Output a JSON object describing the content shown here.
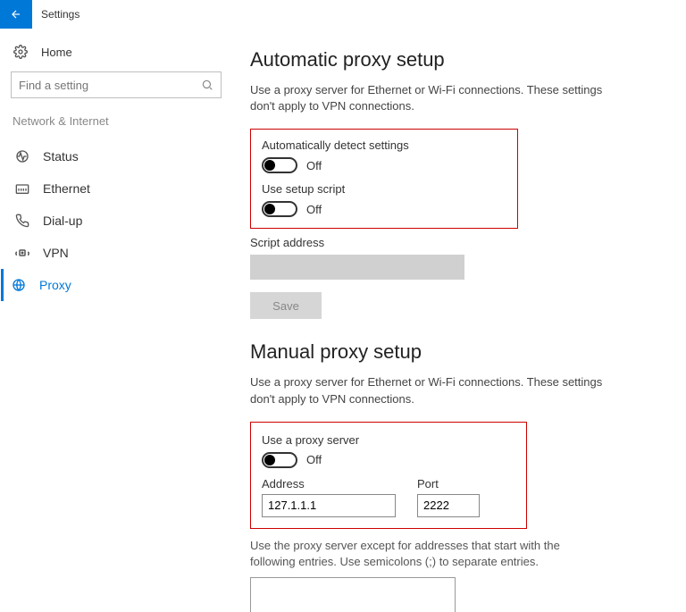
{
  "titlebar": {
    "title": "Settings"
  },
  "sidebar": {
    "home": "Home",
    "search_placeholder": "Find a setting",
    "category": "Network & Internet",
    "items": [
      {
        "label": "Status"
      },
      {
        "label": "Ethernet"
      },
      {
        "label": "Dial-up"
      },
      {
        "label": "VPN"
      },
      {
        "label": "Proxy"
      }
    ]
  },
  "auto": {
    "heading": "Automatic proxy setup",
    "desc": "Use a proxy server for Ethernet or Wi-Fi connections. These settings don't apply to VPN connections.",
    "detect_label": "Automatically detect settings",
    "detect_state": "Off",
    "script_label": "Use setup script",
    "script_state": "Off",
    "script_addr_label": "Script address",
    "save": "Save"
  },
  "manual": {
    "heading": "Manual proxy setup",
    "desc": "Use a proxy server for Ethernet or Wi-Fi connections. These settings don't apply to VPN connections.",
    "use_label": "Use a proxy server",
    "use_state": "Off",
    "addr_label": "Address",
    "addr_value": "127.1.1.1",
    "port_label": "Port",
    "port_value": "2222",
    "note": "Use the proxy server except for addresses that start with the following entries. Use semicolons (;) to separate entries."
  }
}
